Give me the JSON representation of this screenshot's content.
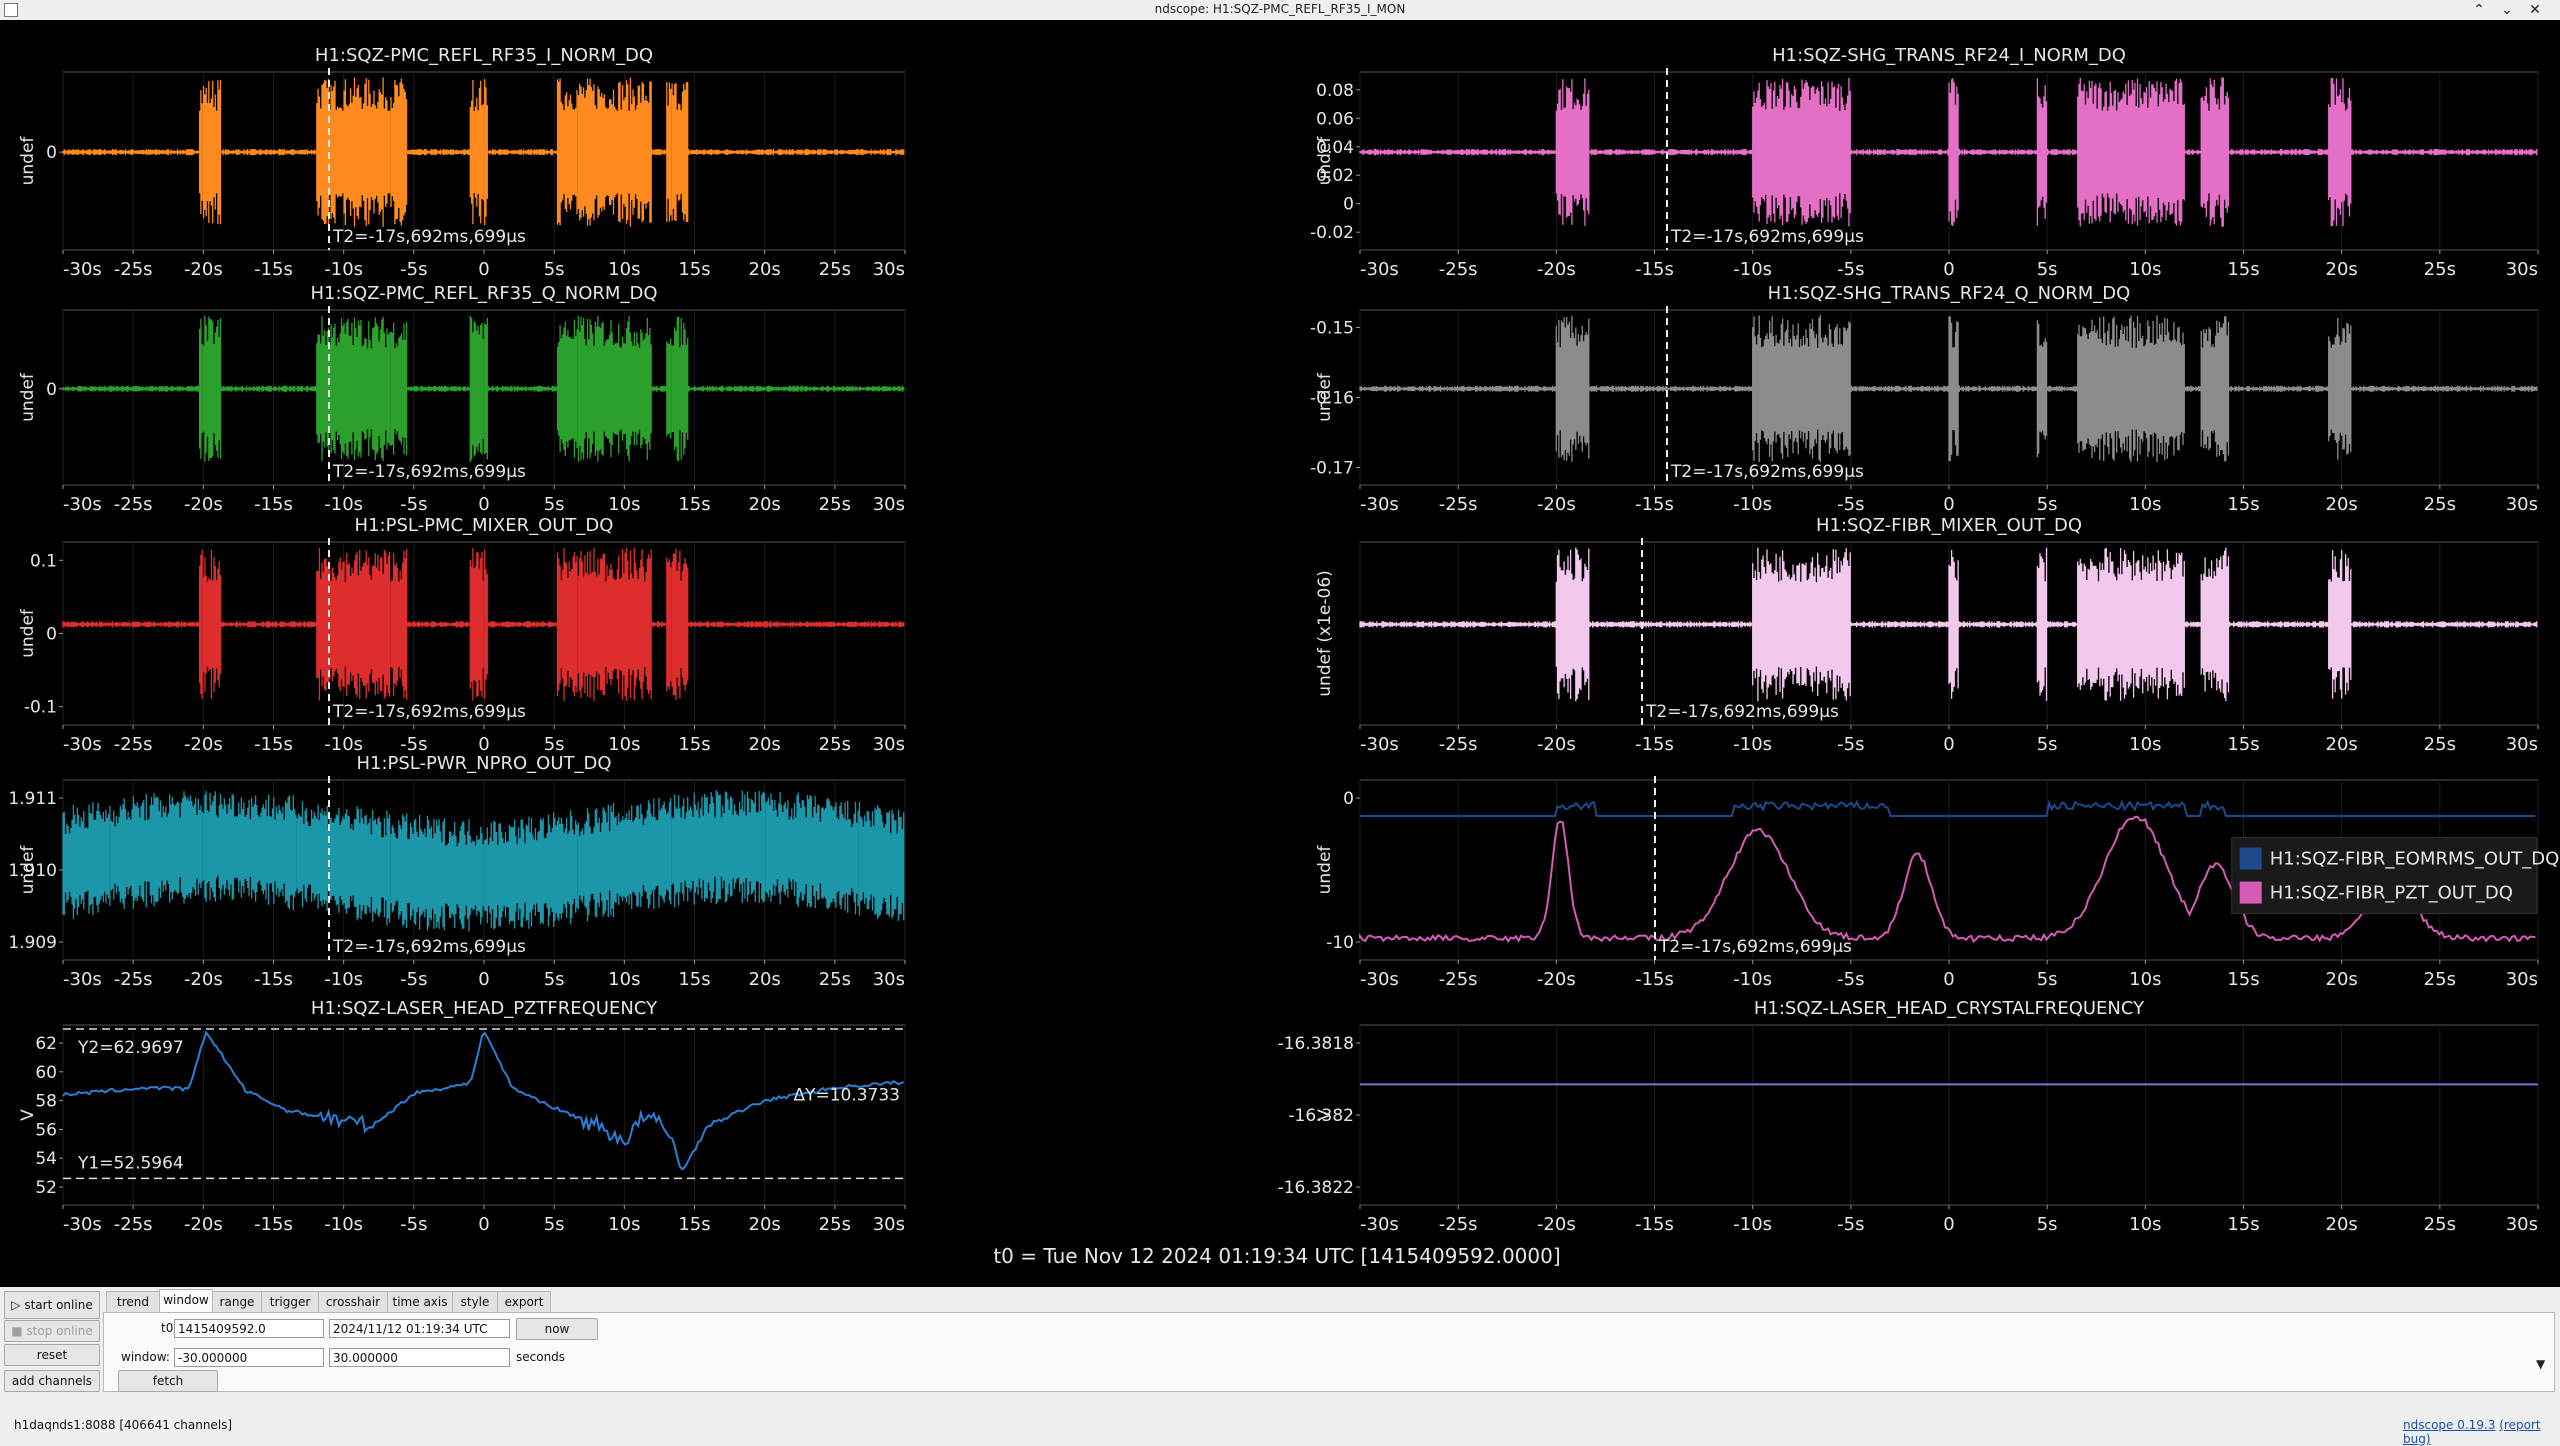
{
  "window": {
    "title": "ndscope: H1:SQZ-PMC_REFL_RF35_I_MON",
    "buttons": {
      "min": "⌃",
      "max": "⌄",
      "close": "✕"
    }
  },
  "t0_label": "t0 = Tue Nov 12 2024 01:19:34 UTC [1415409592.0000]",
  "plots": [
    {
      "title": "H1:SQZ-PMC_REFL_RF35_I_NORM_DQ",
      "ylabel": "undef",
      "yticks": [
        "0"
      ],
      "color": "#ff8a1e",
      "cursor_label": "T2=-17s,692ms,699µs"
    },
    {
      "title": "H1:SQZ-SHG_TRANS_RF24_I_NORM_DQ",
      "ylabel": "undef",
      "yticks": [
        "0.08",
        "0.06",
        "0.04",
        "0.02",
        "0",
        "-0.02"
      ],
      "color": "#e36fc6",
      "cursor_label": "T2=-17s,692ms,699µs"
    },
    {
      "title": "H1:SQZ-PMC_REFL_RF35_Q_NORM_DQ",
      "ylabel": "undef",
      "yticks": [
        "0"
      ],
      "color": "#2ca02c",
      "cursor_label": "T2=-17s,692ms,699µs"
    },
    {
      "title": "H1:SQZ-SHG_TRANS_RF24_Q_NORM_DQ",
      "ylabel": "undef",
      "yticks": [
        "-0.15",
        "-0.16",
        "-0.17"
      ],
      "color": "#8c8c8c",
      "cursor_label": "T2=-17s,692ms,699µs"
    },
    {
      "title": "H1:PSL-PMC_MIXER_OUT_DQ",
      "ylabel": "undef",
      "yticks": [
        "0.1",
        "0",
        "-0.1"
      ],
      "color": "#de2d2d",
      "cursor_label": "T2=-17s,692ms,699µs"
    },
    {
      "title": "H1:SQZ-FIBR_MIXER_OUT_DQ",
      "ylabel": "undef (x1e-06)",
      "yticks": [],
      "color": "#f2c9ec",
      "cursor_label": "T2=-17s,692ms,699µs"
    },
    {
      "title": "H1:PSL-PWR_NPRO_OUT_DQ",
      "ylabel": "undef",
      "yticks": [
        "1.911",
        "1.910",
        "1.909"
      ],
      "color": "#1c97aa",
      "cursor_label": "T2=-17s,692ms,699µs"
    },
    {
      "title": "",
      "ylabel": "undef",
      "yticks": [
        "0",
        "-10"
      ],
      "color": "#d45bb6",
      "cursor_label": "T2=-17s,692ms,699µs",
      "legend": [
        {
          "name": "H1:SQZ-FIBR_EOMRMS_OUT_DQ",
          "color": "#1c4a8c"
        },
        {
          "name": "H1:SQZ-FIBR_PZT_OUT_DQ",
          "color": "#d45bb6"
        }
      ]
    },
    {
      "title": "H1:SQZ-LASER_HEAD_PZTFREQUENCY",
      "ylabel": "V",
      "yticks": [
        "62",
        "60",
        "58",
        "56",
        "54",
        "52"
      ],
      "color": "#2a7fd4",
      "y2_label": "Y2=62.9697",
      "y1_label": "Y1=52.5964",
      "dy_label": "ΔY=10.3733"
    },
    {
      "title": "H1:SQZ-LASER_HEAD_CRYSTALFREQUENCY",
      "ylabel": "V",
      "yticks": [
        "-16.3818",
        "-16.382",
        "-16.3822"
      ],
      "color": "#7b6fd6"
    }
  ],
  "xticks": [
    "-30s",
    "-25s",
    "-20s",
    "-15s",
    "-10s",
    "-5s",
    "0",
    "5s",
    "10s",
    "15s",
    "20s",
    "25s",
    "30s"
  ],
  "controls": {
    "start_online": "start online",
    "stop_online": "stop online",
    "reset": "reset",
    "add_channels": "add channels",
    "tabs": [
      "trend",
      "window",
      "range",
      "trigger",
      "crosshair",
      "time axis",
      "style",
      "export"
    ],
    "active_tab": "window",
    "t0_label": "t0:",
    "t0_gps": "1415409592.0",
    "t0_utc": "2024/11/12 01:19:34 UTC",
    "now": "now",
    "window_label": "window:",
    "window_start": "-30.000000",
    "window_end": "30.000000",
    "seconds": "seconds",
    "fetch": "fetch"
  },
  "status": {
    "server": "h1daqnds1:8088",
    "channels": "[406641 channels]",
    "version": "ndscope 0.19.3",
    "report": "(report bug)"
  }
}
